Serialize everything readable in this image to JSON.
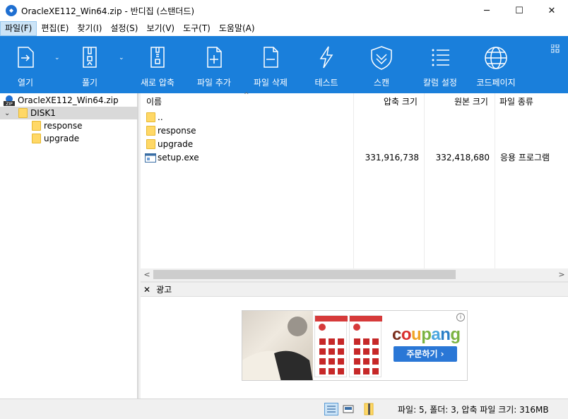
{
  "window": {
    "title": "OracleXE112_Win64.zip - 반디집 (스탠더드)",
    "controls": {
      "minimize": "─",
      "maximize": "☐",
      "close": "✕"
    }
  },
  "menu": [
    {
      "label": "파일(F)"
    },
    {
      "label": "편집(E)"
    },
    {
      "label": "찾기(I)"
    },
    {
      "label": "설정(S)"
    },
    {
      "label": "보기(V)"
    },
    {
      "label": "도구(T)"
    },
    {
      "label": "도움말(A)"
    }
  ],
  "toolbar": {
    "color": "#1a7fdb",
    "buttons": [
      {
        "label": "열기",
        "icon": "open-icon"
      },
      {
        "label": "풀기",
        "icon": "extract-icon"
      },
      {
        "label": "새로 압축",
        "icon": "new-archive-icon"
      },
      {
        "label": "파일 추가",
        "icon": "add-file-icon"
      },
      {
        "label": "파일 삭제",
        "icon": "delete-file-icon"
      },
      {
        "label": "테스트",
        "icon": "test-icon"
      },
      {
        "label": "스캔",
        "icon": "scan-icon"
      },
      {
        "label": "칼럼 설정",
        "icon": "column-settings-icon"
      },
      {
        "label": "코드페이지",
        "icon": "codepage-icon"
      }
    ]
  },
  "tree": {
    "root": "OracleXE112_Win64.zip",
    "items": [
      {
        "label": "DISK1"
      },
      {
        "label": "response"
      },
      {
        "label": "upgrade"
      }
    ]
  },
  "filelist": {
    "columns": {
      "name": "이름",
      "packed": "압축 크기",
      "original": "원본 크기",
      "type": "파일 종류"
    },
    "rows": [
      {
        "name": "..",
        "packed": "",
        "original": "",
        "type": ""
      },
      {
        "name": "response",
        "packed": "",
        "original": "",
        "type": ""
      },
      {
        "name": "upgrade",
        "packed": "",
        "original": "",
        "type": ""
      },
      {
        "name": "setup.exe",
        "packed": "331,916,738",
        "original": "332,418,680",
        "type": "응용 프로그램"
      }
    ]
  },
  "ad": {
    "header": "광고",
    "brand": "coupang",
    "button": "주문하기 ›",
    "info": "i"
  },
  "status": {
    "text": "파일: 5, 폴더: 3, 압축 파일 크기: 316MB"
  }
}
